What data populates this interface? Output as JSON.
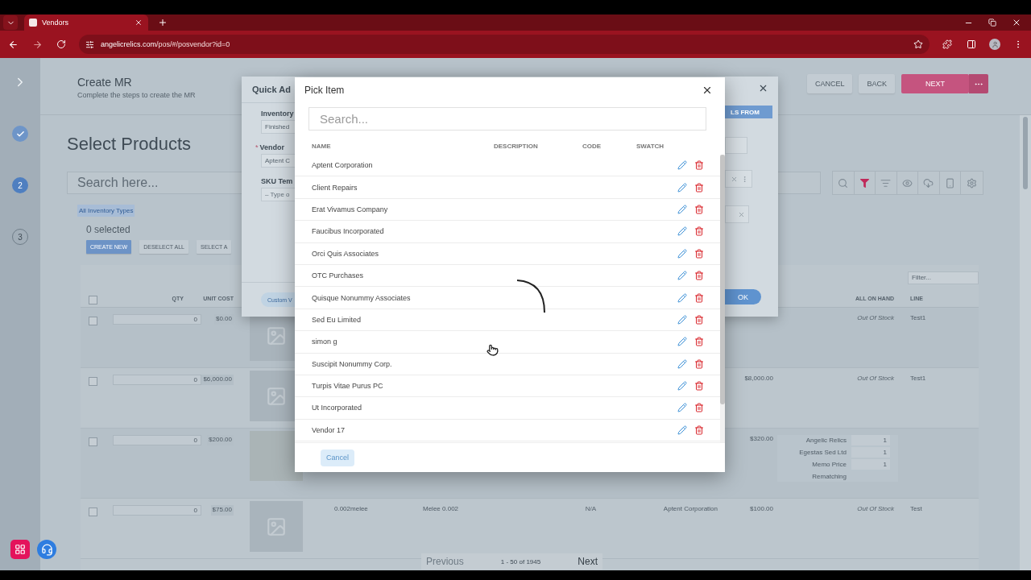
{
  "browser": {
    "tab": {
      "title": "Vendors"
    },
    "url": {
      "host": "angelicrelics.com",
      "path": "/pos/#/posvendor?id=0"
    }
  },
  "steps": [
    {
      "completed": true,
      "selected": false
    },
    {
      "number": "2",
      "completed": false,
      "selected": true
    },
    {
      "number": "3",
      "completed": false,
      "selected": false
    }
  ],
  "header": {
    "title": "Create MR",
    "subtitle": "Complete the steps to create the MR",
    "buttons": [
      {
        "label": "CANCEL",
        "kind": "plain"
      },
      {
        "label": "BACK",
        "kind": "plain"
      },
      {
        "label": "NEXT",
        "kind": "primary"
      }
    ]
  },
  "products": {
    "title": "Select Products",
    "search": {
      "placeholder": "Search here..."
    },
    "filter_chip": "All Inventory Types",
    "selected_count": "0 selected",
    "actions": [
      {
        "label": "CREATE NEW",
        "kind": "primary"
      },
      {
        "label": "DESELECT ALL",
        "kind": "plain"
      },
      {
        "label": "SELECT A",
        "kind": "plain"
      }
    ]
  },
  "table": {
    "filter": {
      "placeholder": "Filter..."
    },
    "select_all_checked": false,
    "columns": {
      "qty": "QTY",
      "unit_cost": "UNIT COST",
      "on_hand": "ALL ON HAND",
      "line": "LINE"
    },
    "rows": [
      {
        "kind": "placeholder",
        "checked": false,
        "qty": "0",
        "unit_cost": "$0.00",
        "stock": "Out Of Stock",
        "line": "Test1"
      },
      {
        "kind": "placeholder",
        "checked": false,
        "qty": "0",
        "unit_cost": "$6,000.00",
        "price": "$8,000.00",
        "stock": "Out Of Stock",
        "line": "Test1"
      },
      {
        "kind": "photo",
        "checked": false,
        "qty": "0",
        "unit_cost": "$200.00",
        "price": "$320.00",
        "breakdown": [
          {
            "label": "Angelic Relics",
            "value": "1"
          },
          {
            "label": "Egestas Sed Ltd",
            "value": "1"
          },
          {
            "label": "Memo Price",
            "value": "1"
          },
          {
            "label": "Rematching"
          }
        ]
      },
      {
        "kind": "placeholder",
        "checked": false,
        "qty": "0",
        "unit_cost": "$75.00",
        "code": "0.002melee",
        "description": "Melee 0.002",
        "status": "N/A",
        "vendor": "Aptent Corporation",
        "price": "$100.00",
        "stock": "Out Of Stock",
        "line": "Test"
      }
    ]
  },
  "quick_add": {
    "title": "Quick Ad",
    "fields": [
      {
        "label": "Inventory",
        "value": "Finished"
      },
      {
        "label": "Vendor",
        "required_mark": "*",
        "value": "Aptent C"
      },
      {
        "label": "SKU Tem",
        "placeholder": "– Type o"
      }
    ],
    "custom_button": "Custom V",
    "details_button": "LS FROM",
    "ok": "OK"
  },
  "pick_item": {
    "title": "Pick Item",
    "search": {
      "placeholder": "Search..."
    },
    "columns": [
      "NAME",
      "DESCRIPTION",
      "CODE",
      "SWATCH"
    ],
    "loading": true,
    "rows": [
      {
        "name": "Aptent Corporation"
      },
      {
        "name": "Client Repairs"
      },
      {
        "name": "Erat Vivamus Company"
      },
      {
        "name": "Faucibus Incorporated"
      },
      {
        "name": "Orci Quis Associates"
      },
      {
        "name": "OTC Purchases"
      },
      {
        "name": "Quisque Nonummy Associates"
      },
      {
        "name": "Sed Eu Limited"
      },
      {
        "name": "simon g"
      },
      {
        "name": "Suscipit Nonummy Corp."
      },
      {
        "name": "Turpis Vitae Purus PC"
      },
      {
        "name": "Ut Incorporated"
      },
      {
        "name": "Vendor 17"
      }
    ],
    "cancel": "Cancel"
  },
  "pagination": {
    "previous": "Previous",
    "previous_disabled": true,
    "range": "1 - 50 of 1945",
    "next": "Next"
  }
}
